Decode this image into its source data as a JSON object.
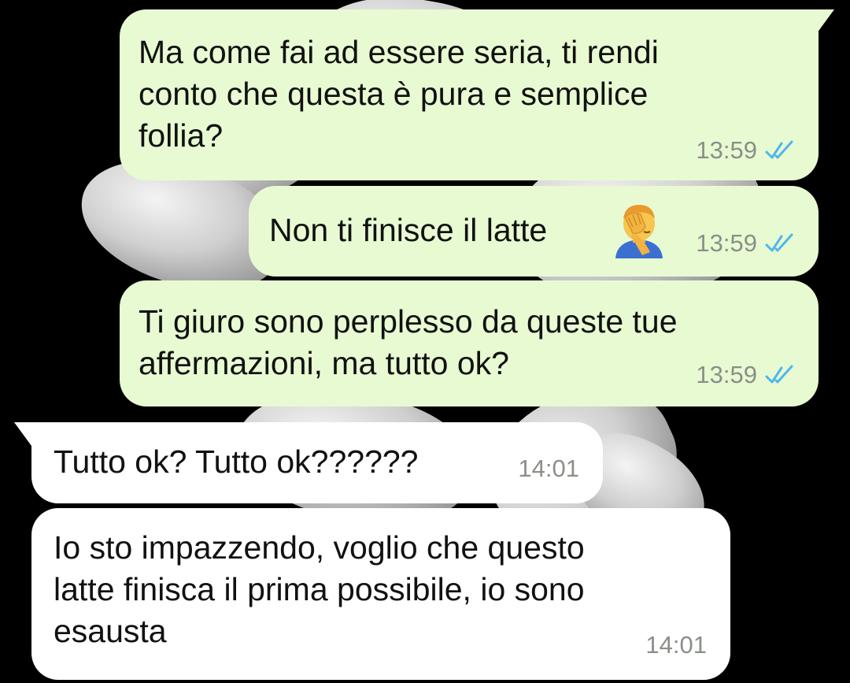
{
  "chat": {
    "messages": [
      {
        "direction": "outgoing",
        "text": "Ma come fai ad essere seria, ti rendi\nconto che questa è pura e semplice\nfollia?",
        "time": "13:59",
        "status": "read-double-check-icon"
      },
      {
        "direction": "outgoing",
        "text": "Non ti finisce il latte",
        "emoji": "facepalm-emoji",
        "time": "13:59",
        "status": "read-double-check-icon"
      },
      {
        "direction": "outgoing",
        "text": "Ti giuro sono perplesso da queste tue\naffermazioni, ma tutto ok?",
        "time": "13:59",
        "status": "read-double-check-icon"
      },
      {
        "direction": "incoming",
        "text": "Tutto ok? Tutto ok??????",
        "time": "14:01"
      },
      {
        "direction": "incoming",
        "text": "Io sto impazzendo, voglio che questo\nlatte finisca il prima possibile, io sono\nesausta",
        "time": "14:01"
      }
    ]
  },
  "colors": {
    "outgoing_bubble": "#e8fad2",
    "incoming_bubble": "#ffffff",
    "read_ticks": "#4fb6ec",
    "timestamp": "#8a8f88",
    "wallpaper": "#000000"
  }
}
